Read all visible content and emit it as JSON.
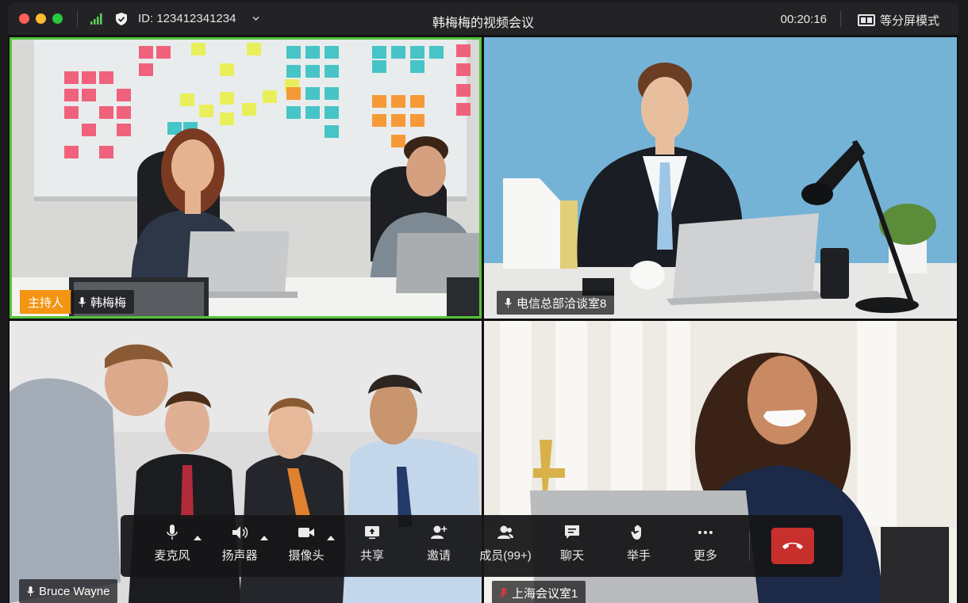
{
  "titlebar": {
    "meeting_id": "ID: 123412341234",
    "title": "韩梅梅的视频会议",
    "timer": "00:20:16",
    "layout_label": "等分屏模式"
  },
  "tiles": [
    {
      "host_badge": "主持人",
      "name": "韩梅梅",
      "mic": "on"
    },
    {
      "name": "电信总部洽谈室8",
      "mic": "on"
    },
    {
      "name": "Bruce Wayne",
      "mic": "on"
    },
    {
      "name": "上海会议室1",
      "mic": "muted"
    }
  ],
  "toolbar": {
    "mic": "麦克风",
    "speaker": "扬声器",
    "camera": "摄像头",
    "share": "共享",
    "invite": "邀请",
    "members": "成员(99+)",
    "chat": "聊天",
    "raise_hand": "举手",
    "more": "更多"
  },
  "colors": {
    "active_speaker_border": "#55c43a",
    "host_badge": "#f39413",
    "hangup": "#c8302d",
    "muted_mic": "#e0383a"
  }
}
